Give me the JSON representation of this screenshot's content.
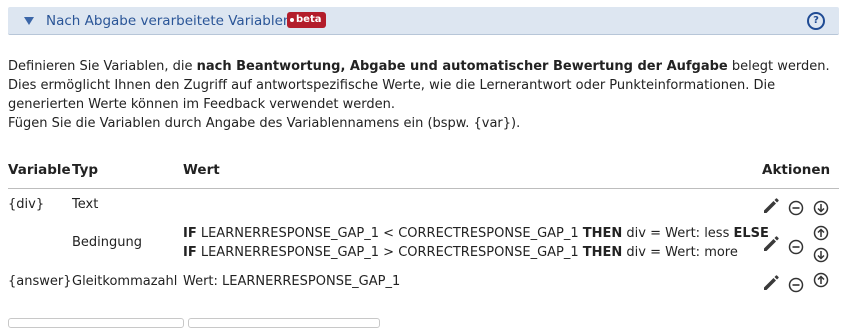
{
  "section": {
    "title": "Nach Abgabe verarbeitete Variablen",
    "badge": "beta",
    "help": "?"
  },
  "description": {
    "p1_before": "Definieren Sie Variablen, die ",
    "p1_bold": "nach Beantwortung, Abgabe und automatischer Bewertung der Aufgabe",
    "p1_after": " belegt werden. Dies ermöglicht Ihnen den Zugriff auf antwortspezifische Werte, wie die Lernerantwort oder Punkteinformationen. Die generierten Werte können im Feedback verwendet werden.",
    "p2": "Fügen Sie die Variablen durch Angabe des Variablennamens ein (bspw. {var})."
  },
  "table": {
    "headers": {
      "variable": "Variable",
      "type": "Typ",
      "value": "Wert",
      "actions": "Aktionen"
    },
    "rows": [
      {
        "variable": "{div}",
        "type": "Text",
        "value": ""
      },
      {
        "variable": "",
        "type": "Bedingung",
        "condition_lines": [
          {
            "kw1": "IF",
            "expr": " LEARNERRESPONSE_GAP_1 < CORRECTRESPONSE_GAP_1 ",
            "kw2": "THEN",
            "result": " div = Wert: less ",
            "kw3": "ELSE"
          },
          {
            "kw1": "IF",
            "expr": " LEARNERRESPONSE_GAP_1 > CORRECTRESPONSE_GAP_1 ",
            "kw2": "THEN",
            "result": " div = Wert: more",
            "kw3": ""
          }
        ]
      },
      {
        "variable": "{answer}",
        "type": "Gleitkommazahl",
        "value": "Wert: LEARNERRESPONSE_GAP_1"
      }
    ]
  },
  "icons": {
    "edit": "pencil-icon",
    "remove": "minus-circle-icon",
    "move_up": "arrow-up-circle-icon",
    "move_down": "arrow-down-circle-icon"
  },
  "colors": {
    "header_bg": "#dde6f1",
    "title": "#2a5597",
    "badge": "#b31d2b"
  }
}
